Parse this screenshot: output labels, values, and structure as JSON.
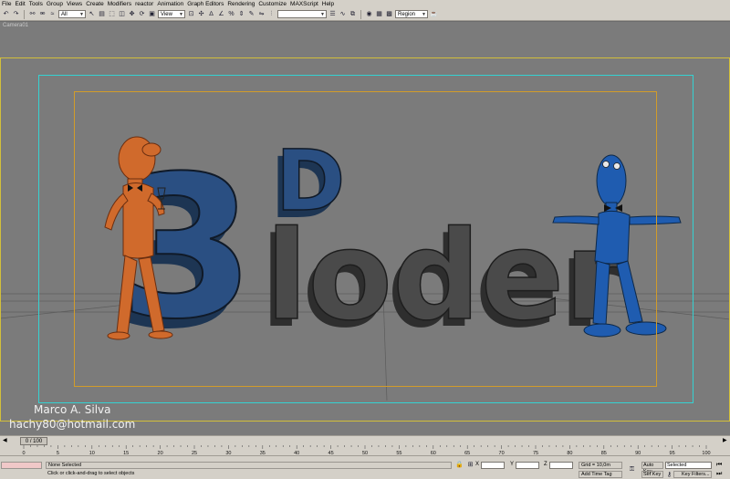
{
  "menu": [
    "File",
    "Edit",
    "Tools",
    "Group",
    "Views",
    "Create",
    "Modifiers",
    "reactor",
    "Animation",
    "Graph Editors",
    "Rendering",
    "Customize",
    "MAXScript",
    "Help"
  ],
  "toolbar": {
    "selection_filter": "All",
    "reference_coord": "View",
    "named_selection": "",
    "selection_region": "Region"
  },
  "viewport": {
    "label": "Camera01",
    "credit_name": "Marco A. Silva",
    "credit_email": "hachy80@hotmail.com",
    "scene_text_3": "3",
    "scene_text_d": "D",
    "scene_text_loder": "loder",
    "colors": {
      "background": "#7b7b7b",
      "blue_letters": "#2a4f82",
      "gray_letters": "#4a4a4a",
      "orange_character": "#d06a2c",
      "blue_character": "#1f5cb0",
      "safe_frame_outer": "#d2bf3a",
      "safe_frame_action": "#35d2d2",
      "safe_frame_title": "#d29c2a"
    }
  },
  "timeslider": {
    "frame_label": "0 / 100"
  },
  "trackbar": {
    "ticks": [
      "0",
      "5",
      "10",
      "15",
      "20",
      "25",
      "30",
      "35",
      "40",
      "45",
      "50",
      "55",
      "60",
      "65",
      "70",
      "75",
      "80",
      "85",
      "90",
      "95",
      "100"
    ]
  },
  "status": {
    "selection": "None Selected",
    "prompt": "Click or click-and-drag to select objects",
    "x_label": "X",
    "y_label": "Y",
    "z_label": "Z",
    "x_value": "",
    "y_value": "",
    "z_value": "",
    "grid": "Grid = 10,0m",
    "add_time_tag": "Add Time Tag",
    "auto_key": "Auto Key",
    "set_key": "Set Key",
    "selected": "Selected",
    "key_filters": "Key Filters..."
  }
}
